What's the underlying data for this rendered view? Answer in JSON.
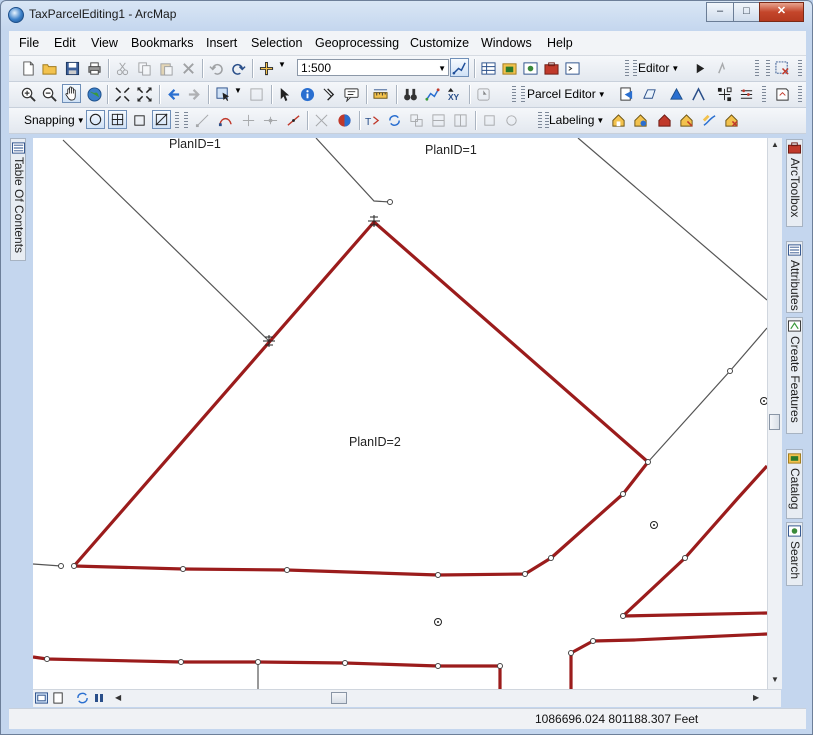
{
  "window": {
    "title": "TaxParcelEditing1 - ArcMap",
    "minimize_label": "–",
    "maximize_label": "□",
    "close_label": "✕"
  },
  "menu": [
    "File",
    "Edit",
    "View",
    "Bookmarks",
    "Insert",
    "Selection",
    "Geoprocessing",
    "Customize",
    "Windows",
    "Help"
  ],
  "toolbar": {
    "scale": "1:500",
    "editor_label": "Editor",
    "parcel_editor_label": "Parcel Editor",
    "snapping_label": "Snapping",
    "labeling_label": "Labeling"
  },
  "left_dock": {
    "toc_label": "Table Of Contents"
  },
  "right_dock": {
    "arctoolbox": "ArcToolbox",
    "attributes": "Attributes",
    "create_features": "Create Features",
    "catalog": "Catalog",
    "search": "Search"
  },
  "map": {
    "labels": [
      "PlanID=1",
      "PlanID=1",
      "PlanID=2"
    ],
    "parcel_color": "#9b1c1c",
    "line_color": "#555555"
  },
  "status": {
    "coordinates": "1086696.024  801188.307 Feet"
  }
}
